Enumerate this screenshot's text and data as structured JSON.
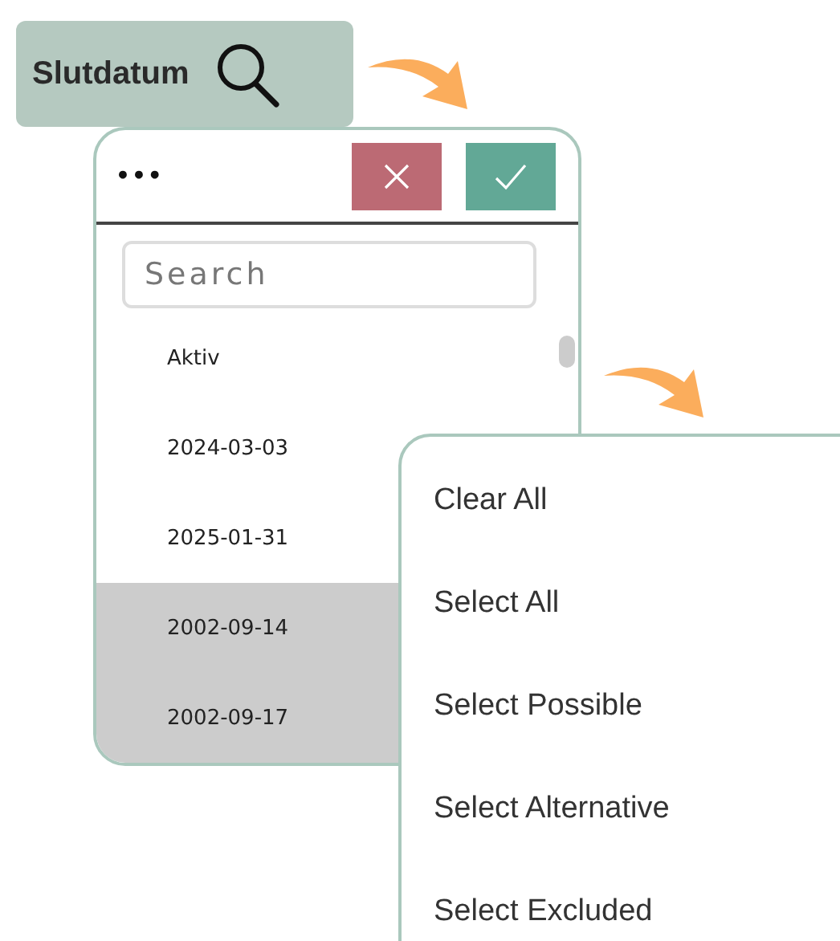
{
  "field_chip": {
    "label": "Slutdatum"
  },
  "listbox": {
    "more": "•••",
    "search": {
      "placeholder": "Search"
    },
    "items": [
      {
        "label": "Aktiv",
        "excluded": false
      },
      {
        "label": "2024-03-03",
        "excluded": false
      },
      {
        "label": "2025-01-31",
        "excluded": false
      },
      {
        "label": "2002-09-14",
        "excluded": true
      },
      {
        "label": "2002-09-17",
        "excluded": true
      }
    ]
  },
  "menu": {
    "items": [
      {
        "label": "Clear All"
      },
      {
        "label": "Select All"
      },
      {
        "label": "Select Possible"
      },
      {
        "label": "Select Alternative"
      },
      {
        "label": "Select Excluded"
      }
    ]
  }
}
